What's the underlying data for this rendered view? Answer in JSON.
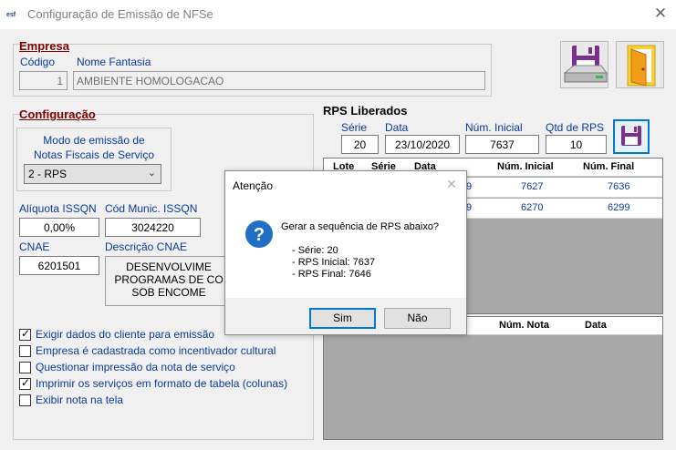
{
  "window": {
    "title": "Configuração de Emissão de NFSe",
    "close_icon": "close-icon"
  },
  "empresa": {
    "section_title": "Empresa",
    "codigo_label": "Código",
    "codigo_value": "1",
    "fantasia_label": "Nome Fantasia",
    "fantasia_value": "AMBIENTE HOMOLOGACAO"
  },
  "toolbar": {
    "save_icon": "floppy-save-icon",
    "exit_icon": "exit-door-icon"
  },
  "configuracao": {
    "section_title": "Configuração",
    "modo_label_line1": "Modo de emissão de",
    "modo_label_line2": "Notas Fiscais de Serviço",
    "modo_value": "2 - RPS",
    "aliquota_label": "Alíquota ISSQN",
    "aliquota_value": "0,00%",
    "cod_munic_label": "Cód Munic. ISSQN",
    "cod_munic_value": "3024220",
    "cnae_label": "CNAE",
    "cnae_value": "6201501",
    "descricao_label": "Descrição CNAE",
    "descricao_line1": "DESENVOLVIME",
    "descricao_line2": "PROGRAMAS DE CO",
    "descricao_line3": "SOB ENCOME",
    "checkboxes": [
      {
        "label": "Exigir dados do cliente para emissão",
        "checked": true
      },
      {
        "label": "Empresa é cadastrada como incentivador cultural",
        "checked": false
      },
      {
        "label": "Questionar impressão da nota de serviço",
        "checked": false
      },
      {
        "label": "Imprimir os serviços em formato de tabela (colunas)",
        "checked": true
      },
      {
        "label": "Exibir nota na tela",
        "checked": false
      }
    ]
  },
  "rps": {
    "section_title": "RPS Liberados",
    "serie_label": "Série",
    "serie_value": "20",
    "data_label": "Data",
    "data_value": "23/10/2020",
    "num_inicial_label": "Núm. Inicial",
    "num_inicial_value": "7637",
    "qtd_label": "Qtd de RPS",
    "qtd_value": "10",
    "grid_headers": [
      "Lote",
      "Série",
      "Data",
      "Núm. Inicial",
      "Núm. Final"
    ],
    "grid_rows": [
      {
        "data_tail": "9",
        "inicial": "7627",
        "final": "7636"
      },
      {
        "data_tail": "9",
        "inicial": "6270",
        "final": "6299"
      }
    ],
    "grid2_headers": [
      "Núm. Nota",
      "Data"
    ]
  },
  "dialog": {
    "title": "Atenção",
    "question": "Gerar a sequência de RPS abaixo?",
    "line_serie": "- Série: 20",
    "line_inicial": "- RPS Inicial: 7637",
    "line_final": "- RPS Final: 7646",
    "yes_label": "Sim",
    "no_label": "Não"
  },
  "colors": {
    "section_title": "#800000",
    "label_blue": "#0b3b9a",
    "accent": "#0078d7",
    "grid_bg": "#a9a9a9"
  }
}
